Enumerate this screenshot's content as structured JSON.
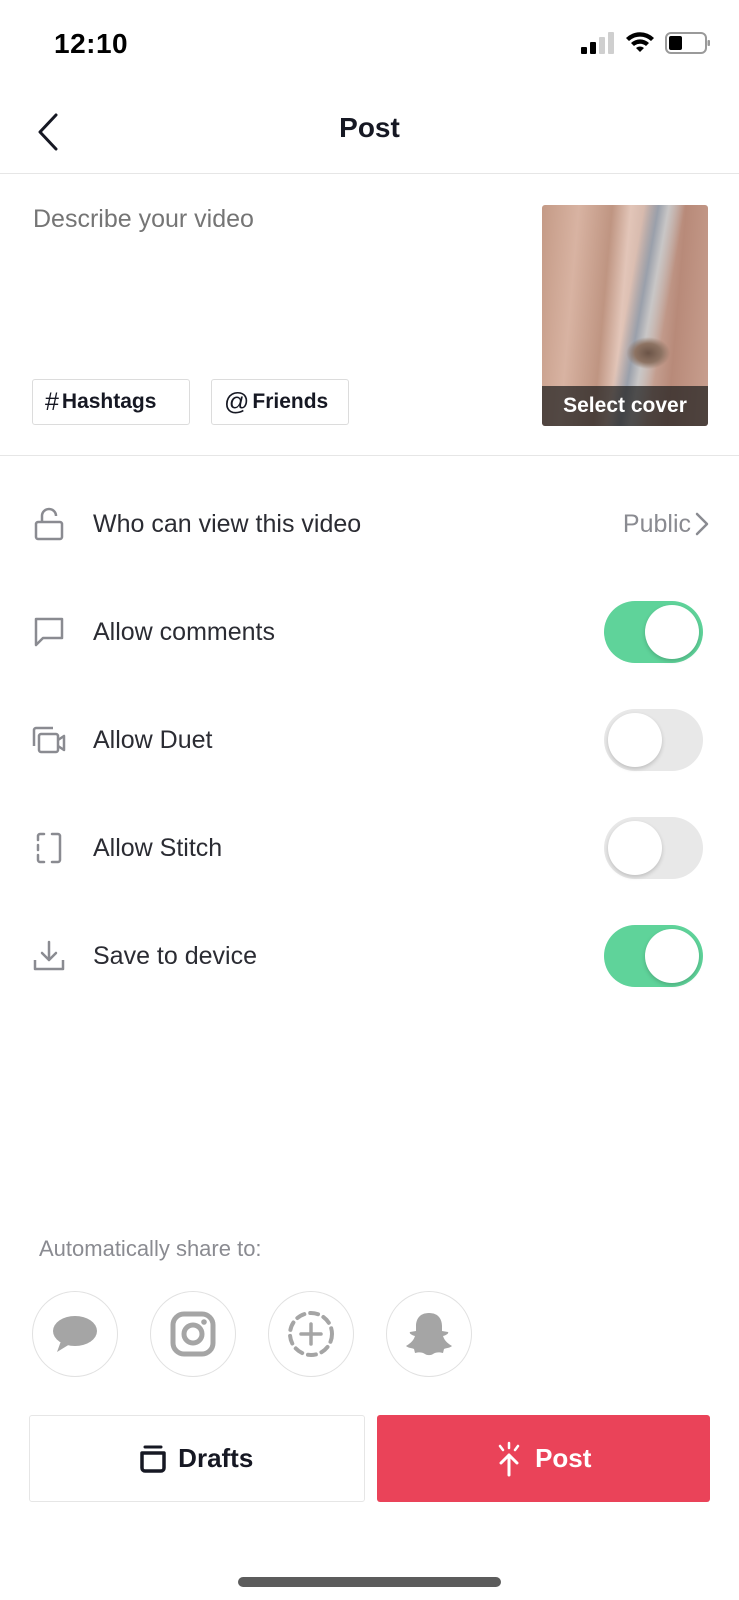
{
  "status_bar": {
    "time": "12:10",
    "icons": [
      "cellular-signal-icon",
      "wifi-icon",
      "battery-icon"
    ],
    "battery_level_percent": 35,
    "signal_bars_active": 2,
    "signal_bars_total": 4
  },
  "nav": {
    "back_icon": "chevron-left-icon",
    "title": "Post"
  },
  "compose": {
    "description_placeholder": "Describe your video",
    "description_value": "",
    "chips": [
      {
        "symbol": "#",
        "label": "Hashtags"
      },
      {
        "symbol": "@",
        "label": "Friends"
      }
    ],
    "cover_label": "Select cover"
  },
  "settings": [
    {
      "icon": "unlock-icon",
      "label": "Who can view this video",
      "value": "Public",
      "type": "link"
    },
    {
      "icon": "comment-icon",
      "label": "Allow comments",
      "type": "toggle",
      "on": true
    },
    {
      "icon": "duet-icon",
      "label": "Allow Duet",
      "type": "toggle",
      "on": false
    },
    {
      "icon": "stitch-icon",
      "label": "Allow Stitch",
      "type": "toggle",
      "on": false
    },
    {
      "icon": "download-icon",
      "label": "Save to device",
      "type": "toggle",
      "on": true
    }
  ],
  "share": {
    "label": "Automatically share to:",
    "targets": [
      {
        "name": "messages",
        "icon": "message-bubble-icon"
      },
      {
        "name": "instagram",
        "icon": "instagram-icon"
      },
      {
        "name": "story",
        "icon": "add-story-icon"
      },
      {
        "name": "snapchat",
        "icon": "snapchat-icon"
      }
    ]
  },
  "actions": {
    "drafts_label": "Drafts",
    "post_label": "Post"
  },
  "colors": {
    "toggle_on": "#5fd39a",
    "toggle_off": "#e8e8e8",
    "post_button": "#ea4359",
    "secondary_text": "#8a8b91"
  }
}
